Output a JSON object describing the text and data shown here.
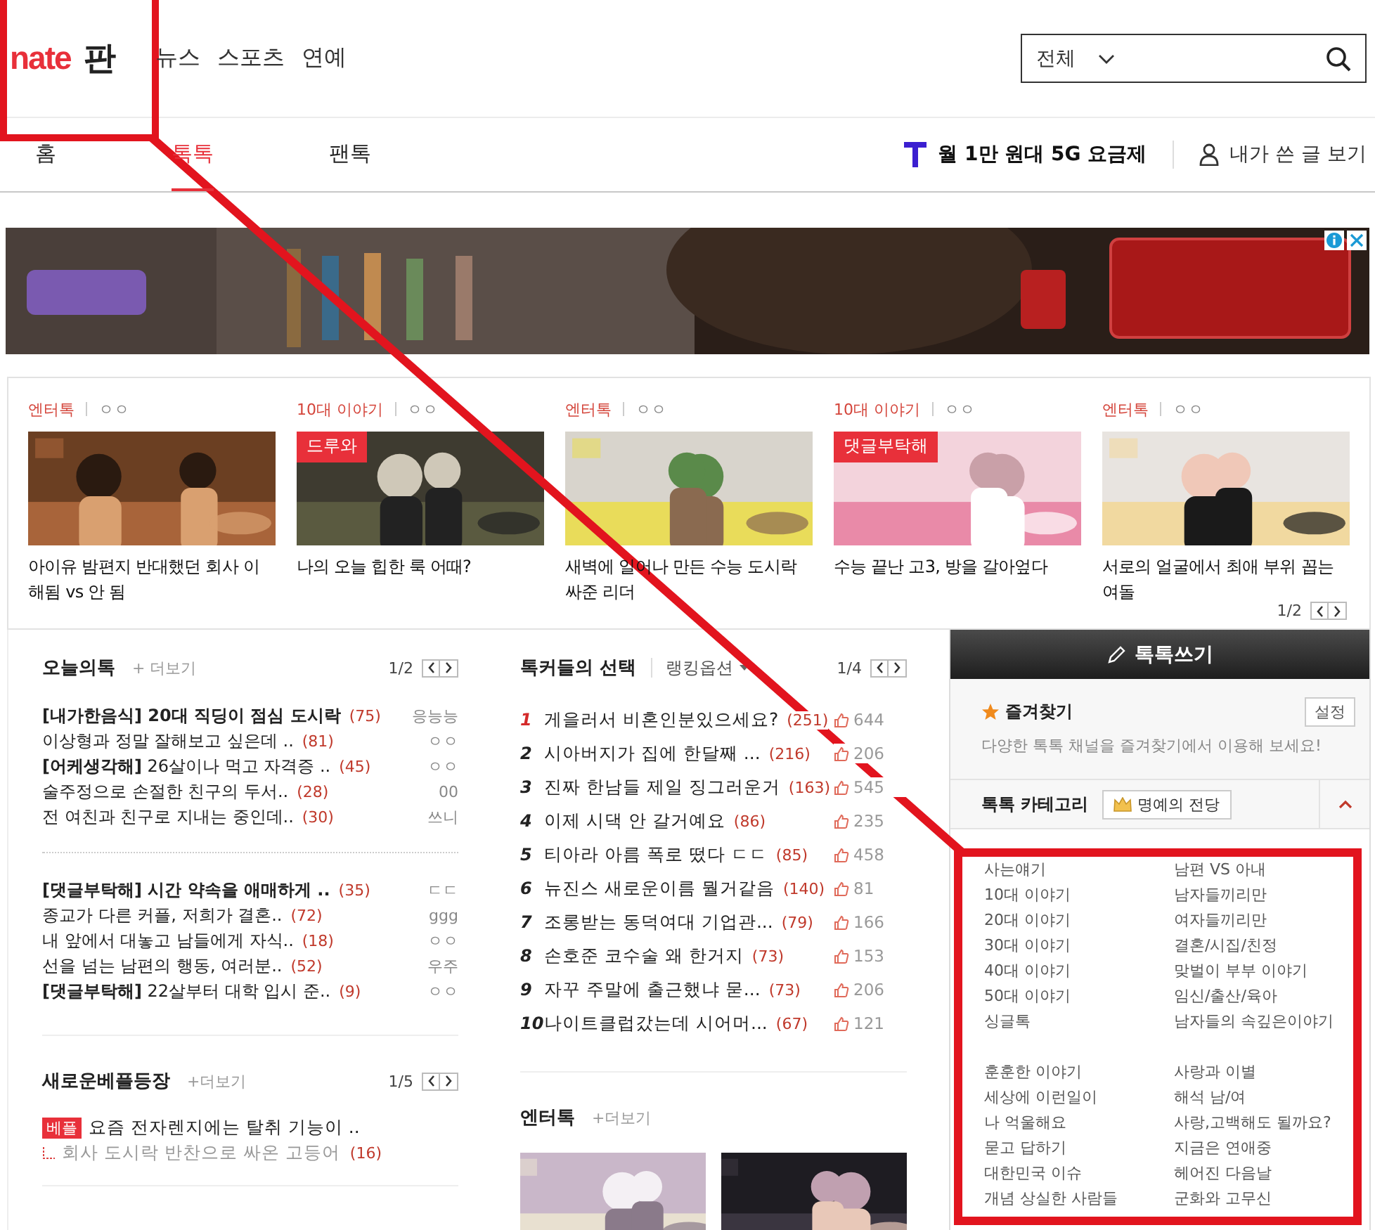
{
  "header": {
    "logo": "nate",
    "logo_sub": "판",
    "nav": [
      "뉴스",
      "스포츠",
      "연예"
    ],
    "search": {
      "scope": "전체"
    }
  },
  "tabs": [
    {
      "label": "홈",
      "selected": false
    },
    {
      "label": "톡톡",
      "selected": true
    },
    {
      "label": "팬톡",
      "selected": false
    }
  ],
  "promo": "월 1만 원대 5G 요금제",
  "my_posts": "내가 쓴 글 보기",
  "featured": {
    "page": "1/2",
    "cards": [
      {
        "category": "엔터톡",
        "author": "ㅇㅇ",
        "title": "아이유 밤편지 반대했던 회사 이 해됨 vs 안 됨"
      },
      {
        "category": "10대 이야기",
        "author": "ㅇㅇ",
        "badge": "드루와",
        "title": "나의 오늘 힙한 룩 어때?"
      },
      {
        "category": "엔터톡",
        "author": "ㅇㅇ",
        "title": "새벽에 일어나 만든 수능 도시락 싸준 리더"
      },
      {
        "category": "10대 이야기",
        "author": "ㅇㅇ",
        "badge": "댓글부탁해",
        "title": "수능 끝난 고3, 방을 갈아엎다"
      },
      {
        "category": "엔터톡",
        "author": "ㅇㅇ",
        "title": "서로의 얼굴에서 최애 부위 꼽는 여돌"
      }
    ]
  },
  "today": {
    "title": "오늘의톡",
    "more": "+ 더보기",
    "page": "1/2",
    "groups": [
      {
        "rows": [
          {
            "title": "[내가한음식] 20대 직딩이 점심 도시락",
            "bold": true,
            "count": "(75)",
            "author": "응능능"
          },
          {
            "title": "이상형과 정말 잘해보고 싶은데 ..",
            "bold": false,
            "count": "(81)",
            "author": "ㅇㅇ"
          },
          {
            "title": "**[어케생각해]** 26살이나 먹고 자격증 ..",
            "bold": false,
            "count": "(45)",
            "author": "ㅇㅇ"
          },
          {
            "title": "술주정으로 손절한 친구의 두서..",
            "bold": false,
            "count": "(28)",
            "author": "00"
          },
          {
            "title": "전 여친과 친구로 지내는 중인데..",
            "bold": false,
            "count": "(30)",
            "author": "쓰니"
          }
        ]
      },
      {
        "rows": [
          {
            "title": "[댓글부탁해] 시간 약속을 애매하게 ..",
            "bold": true,
            "count": "(35)",
            "author": "ㄷㄷ"
          },
          {
            "title": "종교가 다른 커플, 저희가 결혼..",
            "bold": false,
            "count": "(72)",
            "author": "ggg"
          },
          {
            "title": "내 앞에서 대놓고 남들에게 자식..",
            "bold": false,
            "count": "(18)",
            "author": "ㅇㅇ"
          },
          {
            "title": "선을 넘는 남편의 행동, 여러분..",
            "bold": false,
            "count": "(52)",
            "author": "우주"
          },
          {
            "title": "**[댓글부탁해]** 22살부터 대학 입시 준..",
            "bold": false,
            "count": "(9)",
            "author": "ㅇㅇ"
          }
        ]
      }
    ]
  },
  "best": {
    "title": "새로운베플등장",
    "more": "+더보기",
    "page": "1/5",
    "items": [
      {
        "badge": "베플",
        "title": "요즘 전자렌지에는 탈취 기능이 ..",
        "reply": "회사 도시락 반찬으로 싸온 고등어",
        "count": "(16)"
      }
    ]
  },
  "ranking": {
    "title": "톡커들의 선택",
    "option": "랭킹옵션",
    "page": "1/4",
    "items": [
      {
        "rank": "1",
        "highlight": true,
        "title": "게을러서 비혼인분있으세요?",
        "count": "(251)",
        "likes": "644"
      },
      {
        "rank": "2",
        "highlight": false,
        "title": "시아버지가 집에 한달째 ...",
        "count": "(216)",
        "likes": "206"
      },
      {
        "rank": "3",
        "highlight": false,
        "title": "진짜 한남들 제일 징그러운거",
        "count": "(163)",
        "likes": "545"
      },
      {
        "rank": "4",
        "highlight": false,
        "title": "이제 시댁 안 갈거예요",
        "count": "(86)",
        "likes": "235"
      },
      {
        "rank": "5",
        "highlight": false,
        "title": "티아라 아름 폭로 떴다 ㄷㄷ",
        "count": "(85)",
        "likes": "458"
      },
      {
        "rank": "6",
        "highlight": false,
        "title": "뉴진스 새로운이름 뭘거같음",
        "count": "(140)",
        "likes": "81"
      },
      {
        "rank": "7",
        "highlight": false,
        "title": "조롱받는 동덕여대 기업관...",
        "count": "(79)",
        "likes": "166"
      },
      {
        "rank": "8",
        "highlight": false,
        "title": "손호준 코수술 왜 한거지",
        "count": "(73)",
        "likes": "153"
      },
      {
        "rank": "9",
        "highlight": false,
        "title": "자꾸 주말에 출근했냐 묻...",
        "count": "(73)",
        "likes": "206"
      },
      {
        "rank": "10",
        "highlight": false,
        "title": "나이트클럽갔는데 시어머...",
        "count": "(67)",
        "likes": "121"
      }
    ]
  },
  "enter": {
    "title": "엔터톡",
    "more": "+더보기"
  },
  "side": {
    "write": "톡톡쓰기",
    "favorites": {
      "title": "즐겨찾기",
      "button": "설정",
      "desc": "다양한 톡톡 채널을 즐겨찾기에서 이용해 보세요!"
    },
    "categories": {
      "title": "톡톡 카테고리",
      "hall": "명예의 전당",
      "expanded": true,
      "groups": [
        {
          "items": [
            "사는얘기",
            "남편 VS 아내",
            "10대 이야기",
            "남자들끼리만",
            "20대 이야기",
            "여자들끼리만",
            "30대 이야기",
            "결혼/시집/친정",
            "40대 이야기",
            "맞벌이 부부 이야기",
            "50대 이야기",
            "임신/출산/육아",
            "싱글톡",
            "남자들의 속깊은이야기"
          ]
        },
        {
          "items": [
            "훈훈한 이야기",
            "사랑과 이별",
            "세상에 이런일이",
            "해석 남/여",
            "나 억울해요",
            "사랑,고백해도 될까요?",
            "묻고 답하기",
            "지금은 연애중",
            "대한민국 이슈",
            "헤어진 다음날",
            "개념 상실한 사람들",
            "군화와 고무신"
          ]
        }
      ]
    }
  }
}
